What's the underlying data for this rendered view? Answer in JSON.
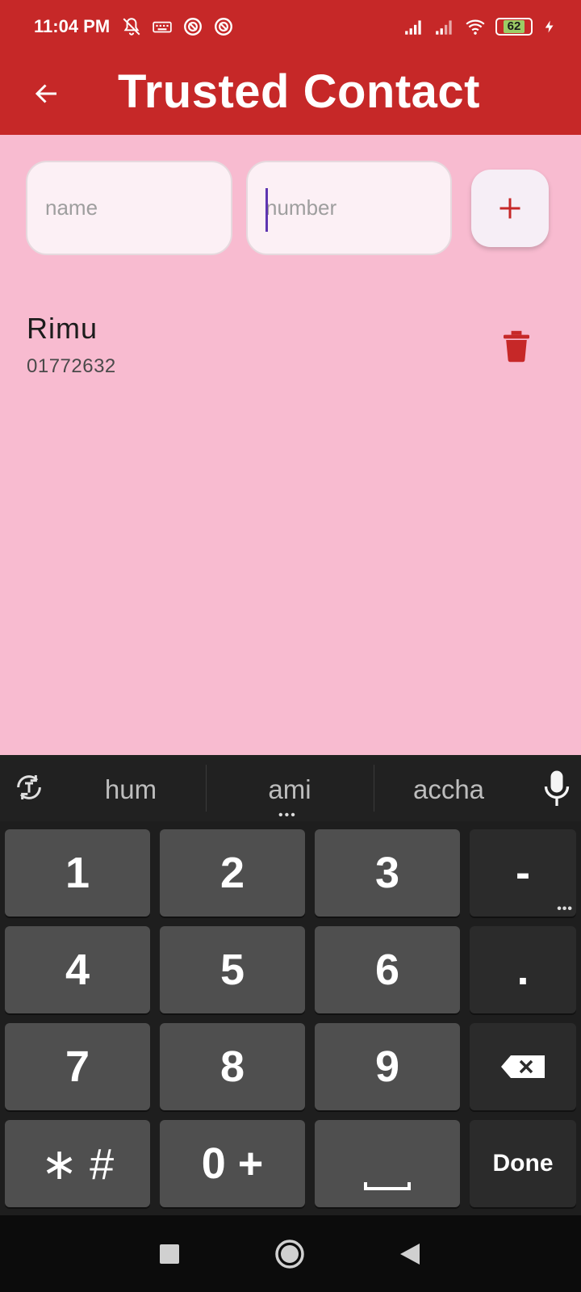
{
  "status_bar": {
    "time": "11:04 PM",
    "battery": "62",
    "icons_left": [
      "mute-icon",
      "keyboard-icon",
      "app-icon",
      "app-icon"
    ],
    "icons_right": [
      "signal-icon",
      "signal-icon",
      "wifi-icon",
      "battery-icon",
      "charging-icon"
    ]
  },
  "app_bar": {
    "title": "Trusted Contact",
    "back_icon": "arrow-left-icon",
    "color": "#c62828"
  },
  "form": {
    "name_placeholder": "name",
    "number_placeholder": "number",
    "add_icon": "plus-icon"
  },
  "contacts": [
    {
      "name": "Rimu",
      "number": "01772632",
      "delete_icon": "trash-icon"
    }
  ],
  "keyboard": {
    "suggestions": [
      "hum",
      "ami",
      "accha"
    ],
    "keys": {
      "k1": "1",
      "k2": "2",
      "k3": "3",
      "dash": "-",
      "k4": "4",
      "k5": "5",
      "k6": "6",
      "dot": ".",
      "k7": "7",
      "k8": "8",
      "k9": "9",
      "star_hash": "∗ #",
      "zero_plus": "0 +",
      "done": "Done"
    }
  },
  "colors": {
    "background": "#f8bbd0",
    "accent": "#c62828",
    "keyboard": "#1e1e1e"
  }
}
